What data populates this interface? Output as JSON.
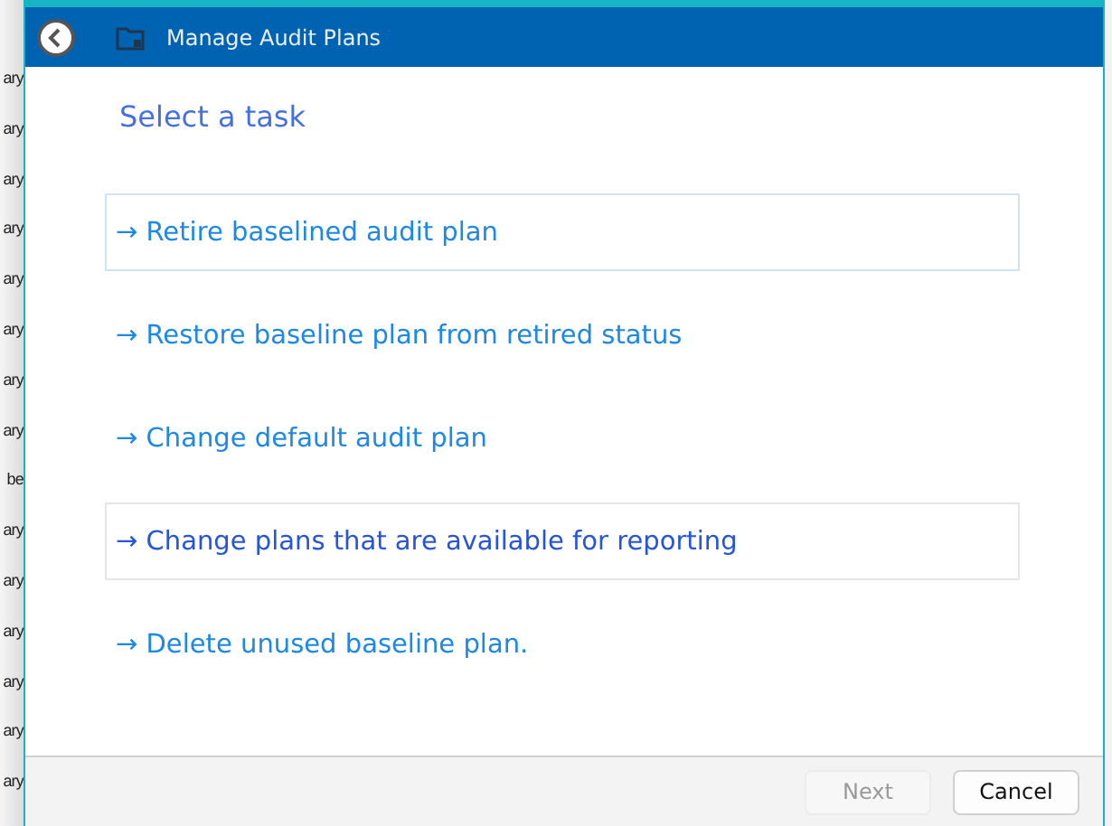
{
  "background_list": {
    "rows": [
      "ary",
      "ary",
      "ary",
      "ary",
      "ary",
      "ary",
      "ary",
      "ary",
      "be",
      "ary",
      "ary",
      "ary",
      "ary",
      "ary",
      "ary"
    ]
  },
  "window": {
    "title": "Manage Audit Plans"
  },
  "heading": "Select a task",
  "tasks": [
    {
      "arrow": "→",
      "label": "Retire baselined audit plan",
      "focused": true,
      "hovered": false
    },
    {
      "arrow": "→",
      "label": "Restore baseline plan from retired status",
      "focused": false,
      "hovered": false
    },
    {
      "arrow": "→",
      "label": "Change default audit plan",
      "focused": false,
      "hovered": false
    },
    {
      "arrow": "→",
      "label": "Change plans that are available for reporting",
      "focused": false,
      "hovered": true
    },
    {
      "arrow": "→",
      "label": "Delete unused baseline plan.",
      "focused": false,
      "hovered": false
    }
  ],
  "buttons": [
    {
      "label": "Next",
      "disabled": true
    },
    {
      "label": "Cancel",
      "disabled": false
    }
  ]
}
